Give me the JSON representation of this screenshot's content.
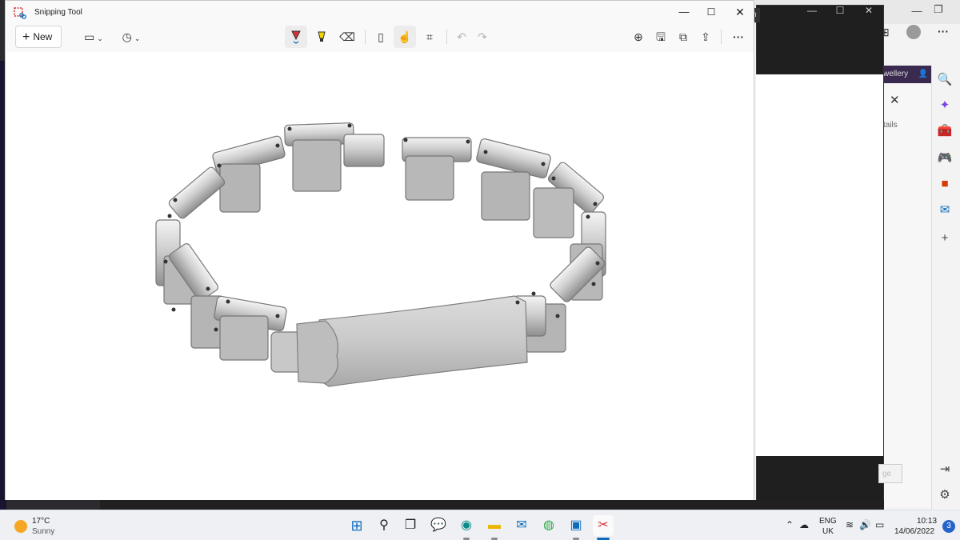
{
  "snipping_tool": {
    "title": "Snipping Tool",
    "new_label": "New"
  },
  "background": {
    "dark_tab_fragment": "n",
    "edge_purple_text": "wellery",
    "panel_text": "tails",
    "panel_button": "ge"
  },
  "taskbar": {
    "weather_temp": "17°C",
    "weather_condition": "Sunny",
    "lang_top": "ENG",
    "lang_bottom": "UK",
    "time": "10:13",
    "date": "14/06/2022",
    "notification_count": "3"
  },
  "colors": {
    "accent": "#2563c9",
    "snip_bg": "#f9f9f9",
    "weather_sun": "#f5a623"
  }
}
